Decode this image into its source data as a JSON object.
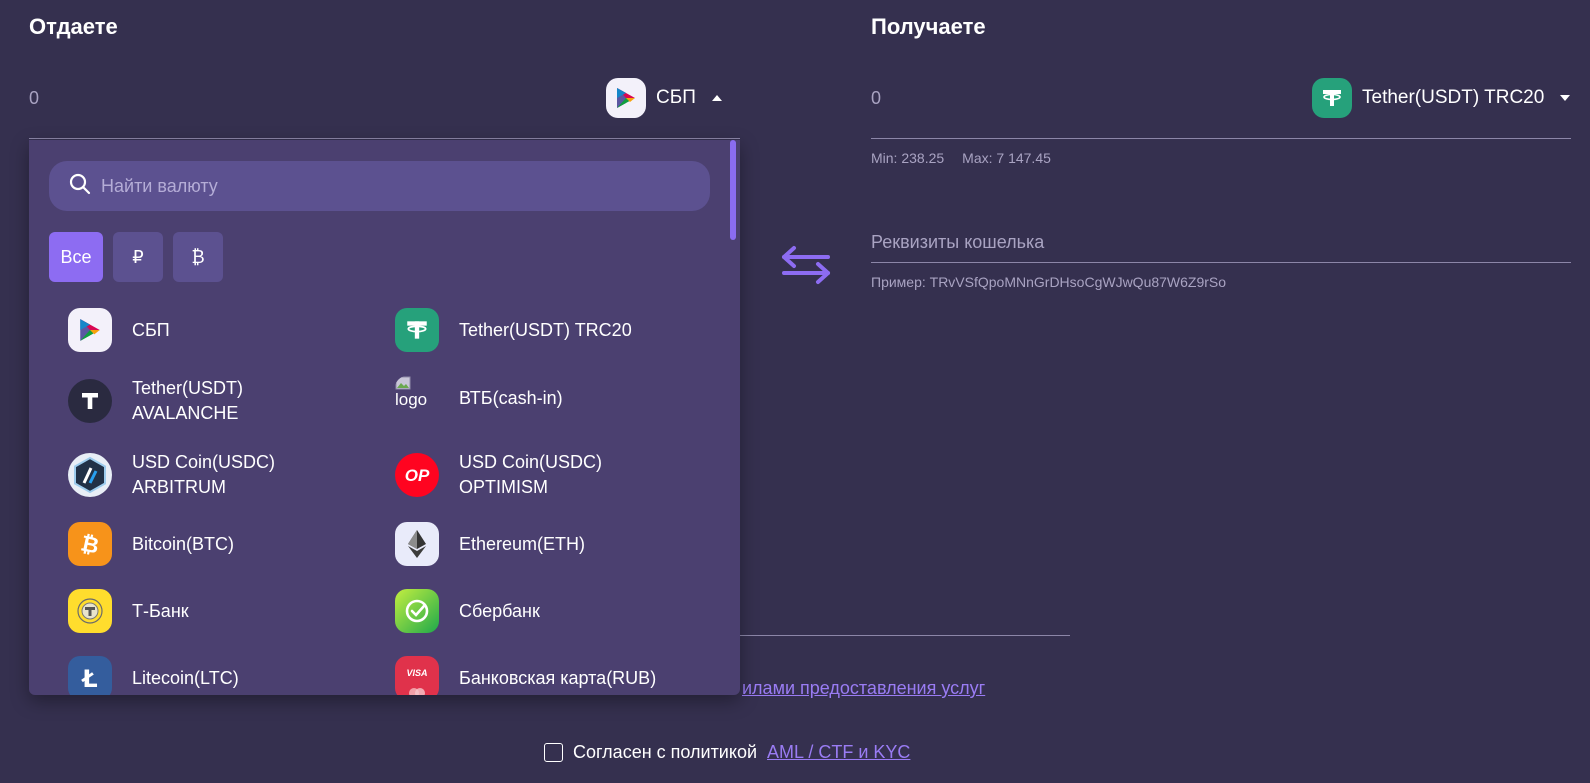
{
  "give": {
    "title": "Отдаете",
    "amount": "0",
    "currency": "СБП"
  },
  "receive": {
    "title": "Получаете",
    "amount": "0",
    "currency": "Tether(USDT) TRC20",
    "min": "Min: 238.25",
    "max": "Max: 7 147.45",
    "wallet_label": "Реквизиты кошелька",
    "wallet_hint": "Пример: TRvVSfQpoMNnGrDHsoCgWJwQu87W6Z9rSo"
  },
  "dropdown": {
    "search_placeholder": "Найти валюту",
    "filters": [
      "Все",
      "₽",
      "₿"
    ],
    "items": [
      {
        "label": "СБП",
        "icon": "sbp-icon"
      },
      {
        "label": "Tether(USDT) TRC20",
        "icon": "tether-icon"
      },
      {
        "label1": "Tether(USDT)",
        "label2": "AVALANCHE",
        "icon": "tether-dark-icon"
      },
      {
        "label": "ВТБ(cash-in)",
        "icon": "broken-logo-image",
        "alt": "logo"
      },
      {
        "label1": "USD Coin(USDC)",
        "label2": "ARBITRUM",
        "icon": "arbitrum-icon"
      },
      {
        "label1": "USD Coin(USDC)",
        "label2": "OPTIMISM",
        "icon": "optimism-icon",
        "icon_text": "OP"
      },
      {
        "label": "Bitcoin(BTC)",
        "icon": "bitcoin-icon"
      },
      {
        "label": "Ethereum(ETH)",
        "icon": "ethereum-icon"
      },
      {
        "label": "Т-Банк",
        "icon": "tbank-icon"
      },
      {
        "label": "Сбербанк",
        "icon": "sberbank-icon"
      },
      {
        "label": "Litecoin(LTC)",
        "icon": "litecoin-icon"
      },
      {
        "label": "Банковская карта(RUB)",
        "icon": "visa-card-icon",
        "icon_text": "VISA"
      }
    ]
  },
  "rules_link": "илами предоставления услуг",
  "agree": {
    "text": "Согласен с политикой",
    "link": "AML / CTF и KYC"
  },
  "colors": {
    "background": "#35304f",
    "dropdown": "#4b4070",
    "accent": "#8d6cf2",
    "link": "#9a7cf4"
  }
}
